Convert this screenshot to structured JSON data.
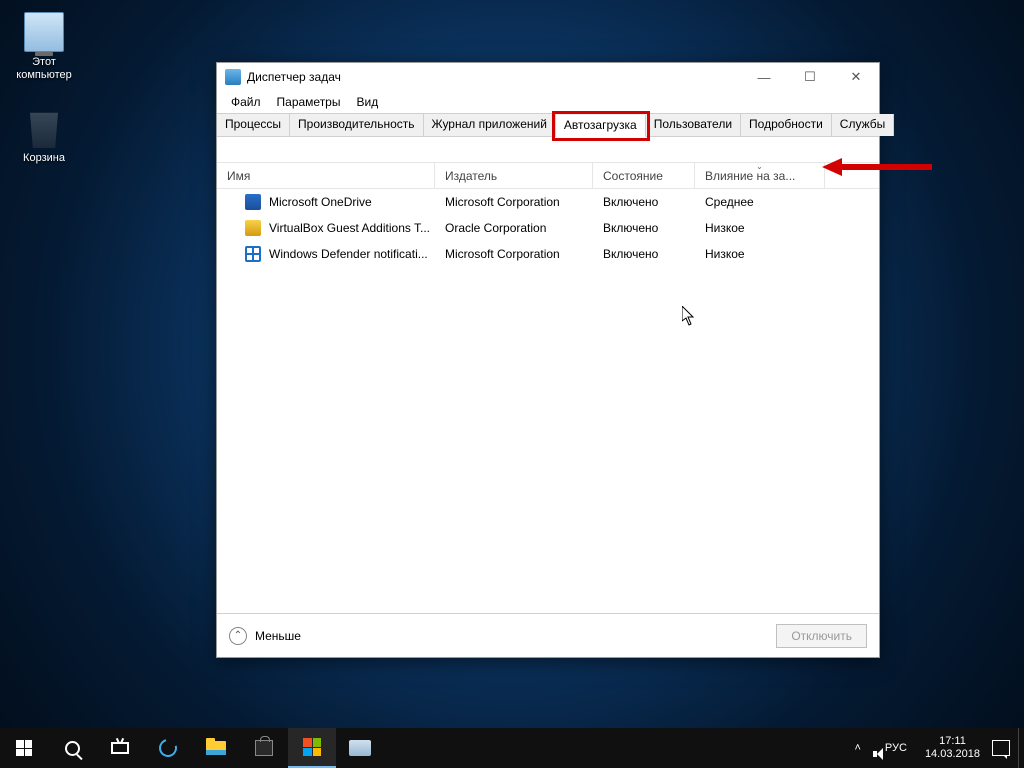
{
  "desktop": {
    "icons": [
      {
        "label": "Этот\nкомпьютер"
      },
      {
        "label": "Корзина"
      }
    ]
  },
  "window": {
    "title": "Диспетчер задач",
    "menu": [
      "Файл",
      "Параметры",
      "Вид"
    ],
    "tabs": [
      "Процессы",
      "Производительность",
      "Журнал приложений",
      "Автозагрузка",
      "Пользователи",
      "Подробности",
      "Службы"
    ],
    "active_tab_index": 3,
    "columns": [
      "Имя",
      "Издатель",
      "Состояние",
      "Влияние на за..."
    ],
    "sort_column_index": 3,
    "rows": [
      {
        "name": "Microsoft OneDrive",
        "publisher": "Microsoft Corporation",
        "state": "Включено",
        "impact": "Среднее",
        "icon": "ic-od"
      },
      {
        "name": "VirtualBox Guest Additions T...",
        "publisher": "Oracle Corporation",
        "state": "Включено",
        "impact": "Низкое",
        "icon": "ic-vb"
      },
      {
        "name": "Windows Defender notificati...",
        "publisher": "Microsoft Corporation",
        "state": "Включено",
        "impact": "Низкое",
        "icon": "ic-wd"
      }
    ],
    "footer": {
      "fewer": "Меньше",
      "disable": "Отключить"
    }
  },
  "taskbar": {
    "lang": "РУС",
    "time": "17:11",
    "date": "14.03.2018"
  }
}
